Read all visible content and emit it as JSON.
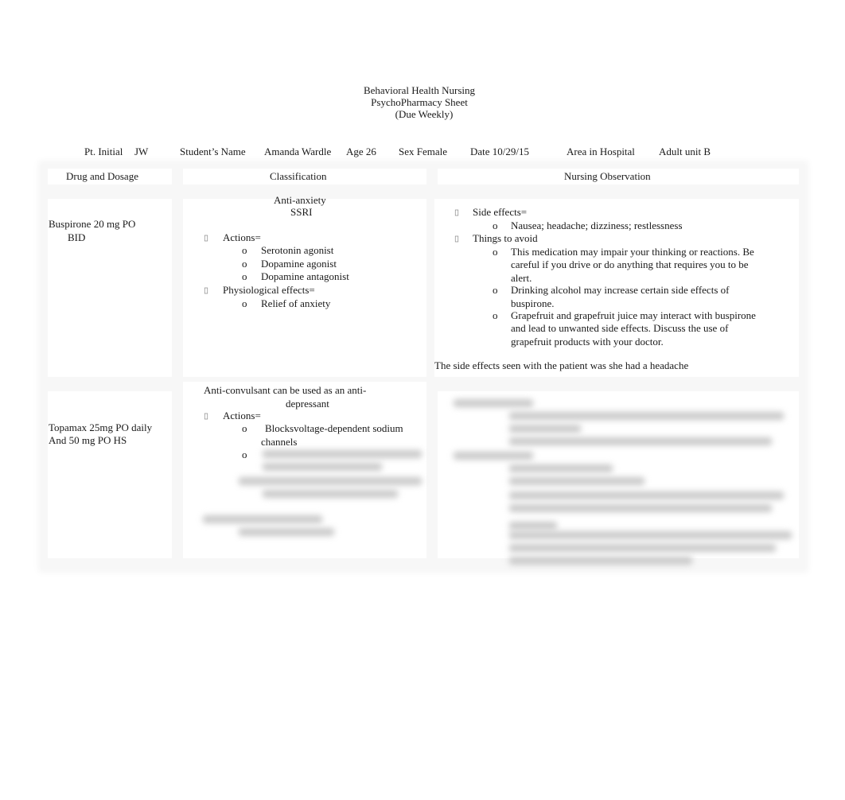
{
  "header": {
    "title_line1": "Behavioral Health Nursing",
    "title_line2": "PsychoPharmacy Sheet",
    "title_line3": "(Due Weekly)"
  },
  "info": {
    "pt_initial_label": "Pt. Initial",
    "pt_initial_value": "JW",
    "student_name_label": "Student’s Name",
    "student_name_value": "Amanda Wardle",
    "age": "Age 26",
    "sex": "Sex Female",
    "date": "Date 10/29/15",
    "area_label": "Area in Hospital",
    "area_value": "Adult unit B"
  },
  "table": {
    "columns": [
      "Drug and Dosage",
      "Classification",
      "Nursing Observation"
    ],
    "rows": [
      {
        "drug_line1": "Buspirone 20 mg PO",
        "drug_line2": "BID",
        "class_line1": "Anti-anxiety",
        "class_line2": "SSRI",
        "actions_label": "Actions=",
        "actions": [
          "Serotonin agonist",
          "Dopamine agonist",
          "Dopamine antagonist"
        ],
        "physio_label": "Physiological effects=",
        "physio": [
          "Relief of anxiety"
        ],
        "side_effects_label": "Side effects=",
        "side_effects": [
          "Nausea; headache; dizziness; restlessness"
        ],
        "avoid_label": "Things to avoid",
        "avoid": [
          [
            "This medication may impair your thinking or reactions. Be",
            "careful if you drive or do anything that requires you to be",
            "alert."
          ],
          [
            "Drinking alcohol may increase certain side effects of",
            "buspirone."
          ],
          [
            "Grapefruit and grapefruit juice may interact with buspirone",
            "and lead to unwanted side effects. Discuss the use of",
            "grapefruit products with your doctor."
          ]
        ],
        "observation": "The side effects seen with the patient was she had a headache"
      },
      {
        "drug_line1": "Topamax 25mg PO daily",
        "drug_line2": "And 50 mg PO HS",
        "class_line1": "Anti-convulsant can be used as an anti-",
        "class_line2": "depressant",
        "actions_label": "Actions=",
        "action1_line1": "Blocksvoltage-dependent sodium",
        "action1_line2": "channels",
        "bullet_o": "o"
      }
    ]
  },
  "icons": {
    "bullet_square": "missing-glyph-square",
    "bullet_o": "o"
  }
}
